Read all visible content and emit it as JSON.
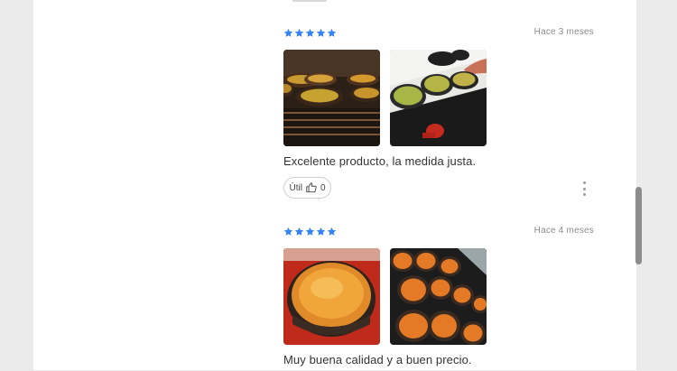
{
  "colors": {
    "star": "#3483fa",
    "text": "#333333",
    "muted": "#8c8c8c"
  },
  "reviews": [
    {
      "rating": 5,
      "date": "Hace 3 meses",
      "photos": [
        "oven-cazuelas-photo",
        "stove-cazuelas-photo"
      ],
      "text": "Excelente producto, la medida justa.",
      "helpful_label": "Útil",
      "helpful_count": "0"
    },
    {
      "rating": 5,
      "date": "Hace 4 meses",
      "photos": [
        "baked-cazuela-photo",
        "griddle-cazuelas-photo"
      ],
      "text": "Muy buena calidad y a buen precio."
    }
  ],
  "icons": {
    "like": "thumb-up-icon",
    "more": "kebab-menu-icon",
    "star": "star-icon"
  }
}
